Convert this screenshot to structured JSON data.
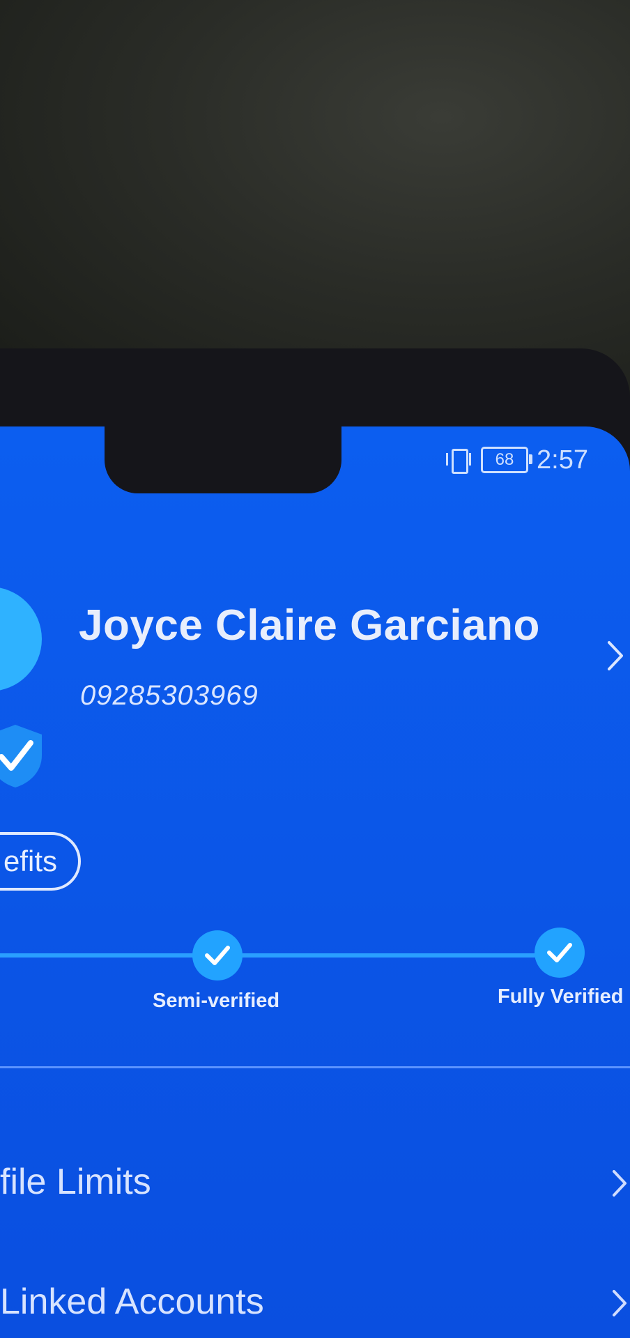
{
  "status_bar": {
    "battery_level": "68",
    "time": "2:57"
  },
  "profile": {
    "name": "Joyce Claire Garciano",
    "phone": "09285303969"
  },
  "benefits_button": {
    "label": "efits"
  },
  "verification": {
    "steps": [
      {
        "label": "Semi-verified",
        "completed": true
      },
      {
        "label": "Fully Verified",
        "completed": true
      }
    ]
  },
  "menu": {
    "items": [
      {
        "label": "file Limits"
      },
      {
        "label": "Linked Accounts"
      }
    ]
  },
  "colors": {
    "screen_blue": "#0c5ef0",
    "accent_light_blue": "#22a3ff",
    "text_white": "#e8eefc"
  },
  "icons": [
    "vibrate-icon",
    "battery-icon",
    "verified-shield-icon",
    "check-icon",
    "chevron-right-icon"
  ]
}
